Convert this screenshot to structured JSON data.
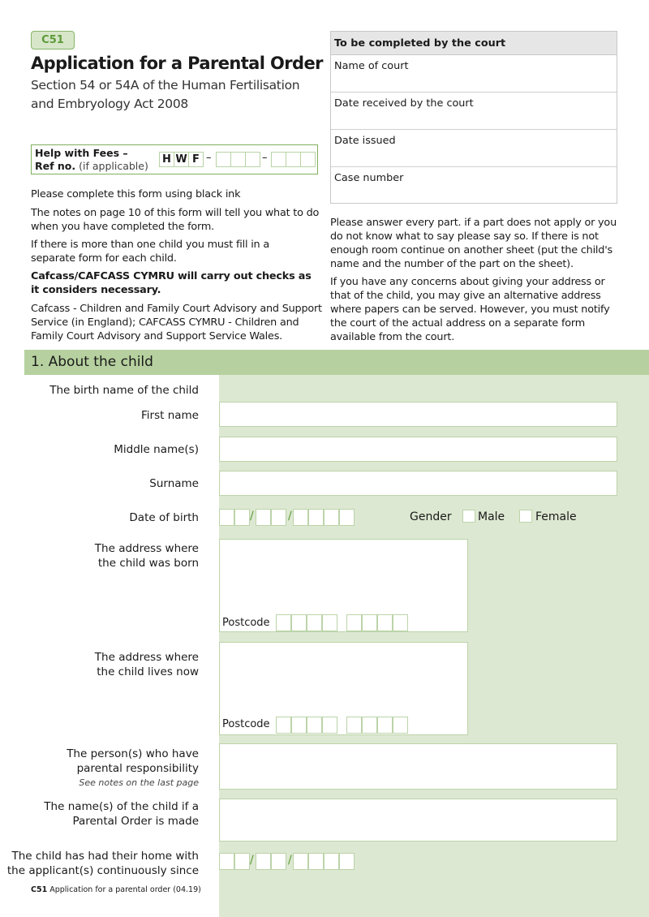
{
  "header": {
    "form_code": "C51",
    "title": "Application for a Parental Order",
    "subtitle": "Section 54 or 54A of the Human Fertilisation and Embryology Act 2008"
  },
  "hwf": {
    "label_line1": "Help with Fees –",
    "label_ref": "Ref no.",
    "label_applicable": "(if applicable)",
    "prefix": [
      "H",
      "W",
      "F"
    ],
    "dash": "–"
  },
  "court": {
    "heading": "To be completed by the court",
    "rows": [
      "Name of court",
      "Date received by the court",
      "Date issued",
      "Case number"
    ]
  },
  "left_notes": [
    "Please complete this form using black ink",
    "The notes on page 10 of this form will tell you what to do when you have completed the form.",
    "If there is more than one child you must fill in a separate form for each child.",
    "Cafcass/CAFCASS CYMRU will carry out checks as it considers necessary.",
    "Cafcass - Children and Family Court Advisory and Support Service (in England); CAFCASS CYMRU - Children and Family Court Advisory and Support Service Wales."
  ],
  "right_notes": [
    "Please answer every part. if a part does not apply or you do not know what to say please say so. If there is not enough room continue on another sheet (put the child's name and the number of the part on the sheet).",
    "If you have any concerns about giving your address or that of the child, you may give an alternative address where papers can be served. However, you must notify the court of the actual address on a separate form available from the court."
  ],
  "section": {
    "title": "1. About the child",
    "birth_name": "The birth name of the child",
    "first_name": "First name",
    "middle_name": "Middle name(s)",
    "surname": "Surname",
    "dob": "Date of birth",
    "slash": "/",
    "gender": "Gender",
    "male": "Male",
    "female": "Female",
    "born_address_1": "The address where",
    "born_address_2": "the child was born",
    "postcode": "Postcode",
    "lives_address_1": "The address where",
    "lives_address_2": "the child lives now",
    "pr_1": "The person(s) who have",
    "pr_2": "parental responsibility",
    "pr_note": "See notes on the last page",
    "names_1": "The name(s) of the child if a",
    "names_2": "Parental Order is made",
    "home_1": "The child has had their home with",
    "home_2": "the applicant(s) continuously since"
  },
  "footer": {
    "code": "C51",
    "text": "Application for a parental order (04.19)"
  }
}
